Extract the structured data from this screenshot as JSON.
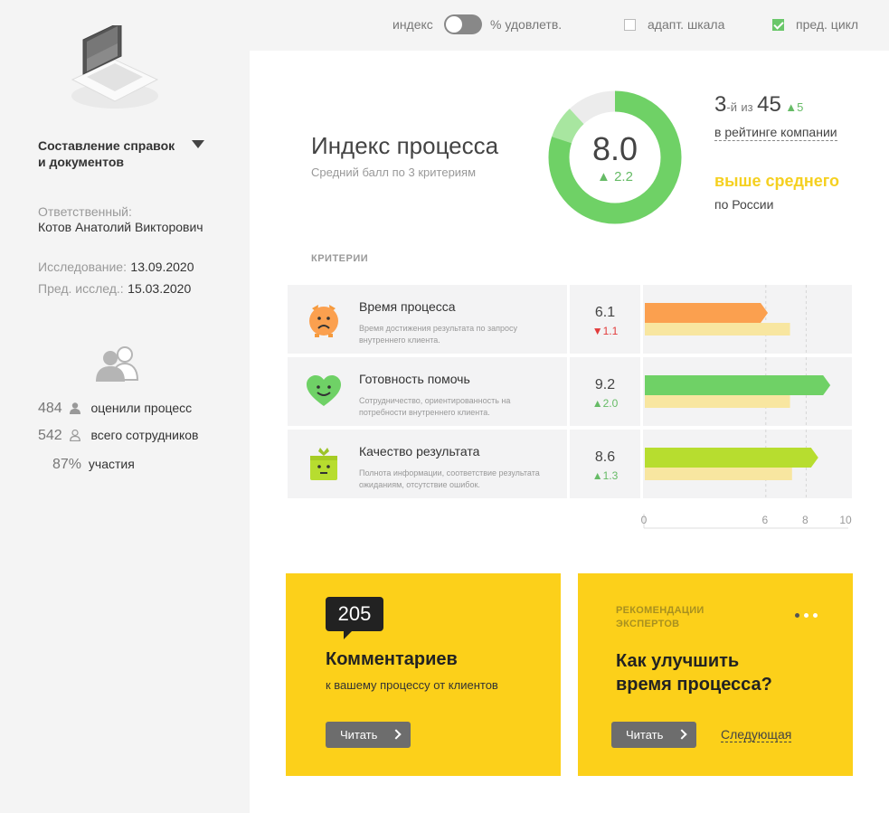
{
  "topbar": {
    "index_label": "индекс",
    "satisfaction_label": "% удовлетв.",
    "adapt_scale_label": "адапт. шкала",
    "prev_cycle_label": "пред. цикл",
    "adapt_scale_checked": false,
    "prev_cycle_checked": true
  },
  "sidebar": {
    "process_title": "Составление справок\nи документов",
    "responsible_label": "Ответственный:",
    "responsible_name": "Котов Анатолий Викторович",
    "study_label": "Исследование:",
    "study_date": "13.09.2020",
    "prev_label": "Пред. исслед.:",
    "prev_date": "15.03.2020",
    "stats": [
      {
        "num": "484",
        "label": "оценили процесс",
        "icon": "user-filled-icon"
      },
      {
        "num": "542",
        "label": "всего сотрудников",
        "icon": "user-outline-icon"
      },
      {
        "num": "87%",
        "label": "участия",
        "icon": ""
      }
    ]
  },
  "index": {
    "title": "Индекс процесса",
    "subtitle": "Средний балл по 3 критериям",
    "value": "8.0",
    "delta": "2.2",
    "score": 8.0,
    "prev_score": 5.8,
    "max": 10
  },
  "rank": {
    "place": "3",
    "suffix": "-й",
    "of": "из",
    "total": "45",
    "change": "5",
    "subtitle": "в рейтинге компании",
    "above": "выше среднего",
    "region": "по России"
  },
  "criteria_label": "КРИТЕРИИ",
  "criteria": [
    {
      "name": "Время процесса",
      "desc": "Время достижения результата по запросу внутреннего клиента.",
      "value": "6.1",
      "delta": "1.1",
      "direction": "down",
      "score": 6.1,
      "prev_score": 7.2,
      "bar_color": "#fba04f",
      "prev_color": "#f8e6a0",
      "icon": "piggy-face-icon"
    },
    {
      "name": "Готовность помочь",
      "desc": "Сотрудничество, ориентированность на потребности внутреннего клиента.",
      "value": "9.2",
      "delta": "2.0",
      "direction": "up",
      "score": 9.2,
      "prev_score": 7.2,
      "bar_color": "#6fd166",
      "prev_color": "#f8e6a0",
      "icon": "heart-face-icon"
    },
    {
      "name": "Качество результата",
      "desc": "Полнота информации, соответствие результата ожиданиям, отсутствие ошибок.",
      "value": "8.6",
      "delta": "1.3",
      "direction": "up",
      "score": 8.6,
      "prev_score": 7.3,
      "bar_color": "#b7dd2f",
      "prev_color": "#f8e6a0",
      "icon": "gift-face-icon"
    }
  ],
  "axis": {
    "ticks": [
      "0",
      "6",
      "8",
      "10"
    ],
    "tick_values": [
      0,
      6,
      8,
      10
    ],
    "max": 10
  },
  "comments_card": {
    "count": "205",
    "title": "Комментариев",
    "subtitle": "к вашему процессу от клиентов",
    "button": "Читать"
  },
  "expert_card": {
    "label": "РЕКОМЕНДАЦИИ\nЭКСПЕРТОВ",
    "title": "Как улучшить\nвремя процесса?",
    "button": "Читать",
    "next": "Следующая"
  },
  "colors": {
    "green": "#66bb66",
    "red": "#e23b3b",
    "yellow_card": "#fcd01a",
    "above_text": "#f5d020"
  }
}
